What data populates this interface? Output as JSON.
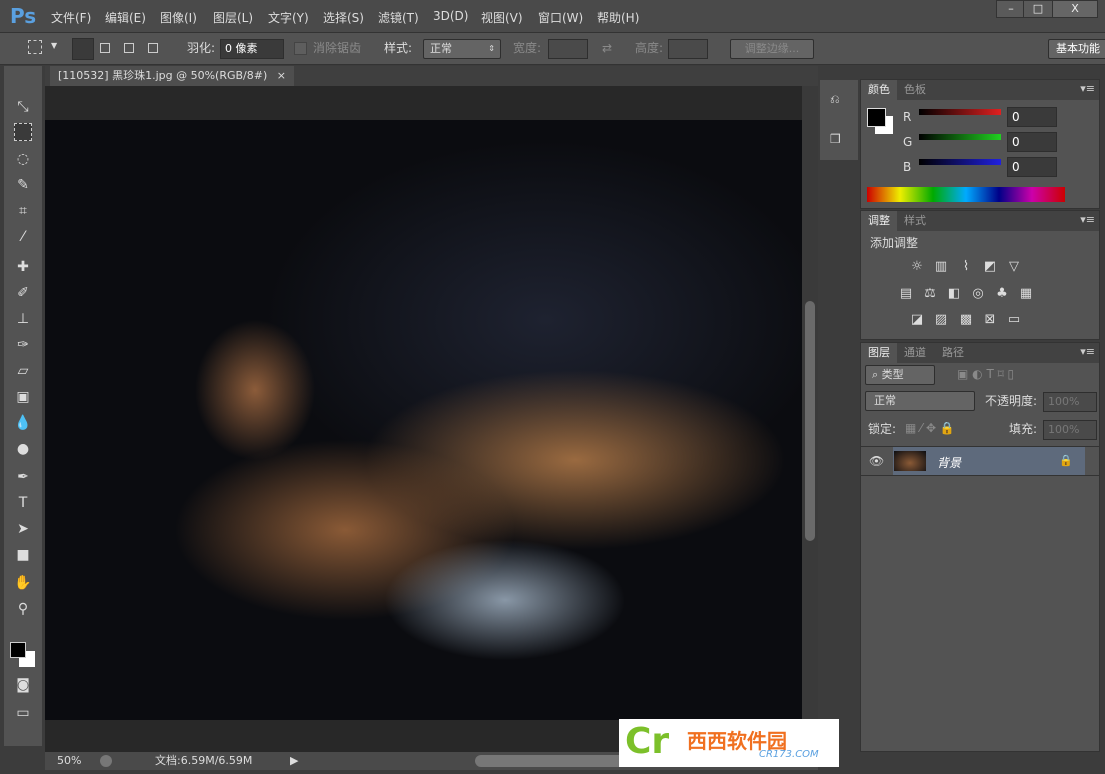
{
  "app": {
    "logo": "Ps",
    "menus": [
      "文件(F)",
      "编辑(E)",
      "图像(I)",
      "图层(L)",
      "文字(Y)",
      "选择(S)",
      "滤镜(T)",
      "3D(D)",
      "视图(V)",
      "窗口(W)",
      "帮助(H)"
    ],
    "window_buttons": [
      "–",
      "□",
      "X"
    ]
  },
  "options": {
    "feather_label": "羽化:",
    "feather_value": "0 像素",
    "antialias": "消除锯齿",
    "style_label": "样式:",
    "style_value": "正常",
    "width_label": "宽度:",
    "height_label": "高度:",
    "refine_edge": "调整边缘...",
    "workspace": "基本功能"
  },
  "document": {
    "tab_title": "[110532] 黑珍珠1.jpg @ 50%(RGB/8#)",
    "close": "×"
  },
  "status": {
    "zoom": "50%",
    "doc_size": "文档:6.59M/6.59M"
  },
  "color_panel": {
    "tabs": [
      "颜色",
      "色板"
    ],
    "channels": [
      {
        "label": "R",
        "value": "0",
        "color": "#e02020"
      },
      {
        "label": "G",
        "value": "0",
        "color": "#20d020"
      },
      {
        "label": "B",
        "value": "0",
        "color": "#2020e0"
      }
    ]
  },
  "adjust_panel": {
    "tabs": [
      "调整",
      "样式"
    ],
    "title": "添加调整"
  },
  "layers_panel": {
    "tabs": [
      "图层",
      "通道",
      "路径"
    ],
    "filter_kind": "类型",
    "blend_mode": "正常",
    "opacity_label": "不透明度:",
    "opacity_value": "100%",
    "lock_label": "锁定:",
    "fill_label": "填充:",
    "fill_value": "100%",
    "layers": [
      {
        "name": "背景",
        "locked": true,
        "visible": true
      }
    ]
  },
  "watermark": {
    "text": "西西软件园",
    "url_text": "CR173.COM"
  }
}
